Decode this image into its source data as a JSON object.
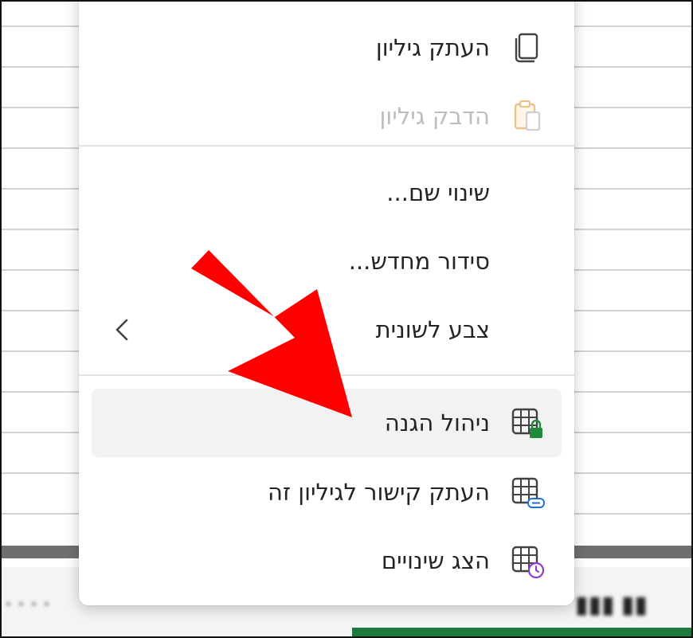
{
  "context_menu": {
    "items": [
      {
        "label": "העתק גיליון",
        "icon": "copy-sheet-icon",
        "enabled": true
      },
      {
        "label": "הדבק גיליון",
        "icon": "paste-sheet-icon",
        "enabled": false
      },
      {
        "label": "שינוי שם...",
        "icon": "",
        "enabled": true
      },
      {
        "label": "סידור מחדש...",
        "icon": "",
        "enabled": true
      },
      {
        "label": "צבע לשונית",
        "icon": "",
        "enabled": true,
        "has_submenu": true
      },
      {
        "label": "ניהול הגנה",
        "icon": "grid-lock-icon",
        "enabled": true,
        "highlighted": true
      },
      {
        "label": "העתק קישור לגיליון זה",
        "icon": "grid-link-icon",
        "enabled": true
      },
      {
        "label": "הצג שינויים",
        "icon": "grid-history-icon",
        "enabled": true
      }
    ]
  },
  "callout": {
    "type": "arrow",
    "color": "#ff0000",
    "points_to": "ניהול הגנה"
  },
  "colors": {
    "protection_lock": "#1e8a3a",
    "link_badge": "#1d6fd6",
    "history_badge": "#8a3ccf",
    "paste_disabled": "#e9c28a",
    "status_accent": "#1e7a3c"
  }
}
